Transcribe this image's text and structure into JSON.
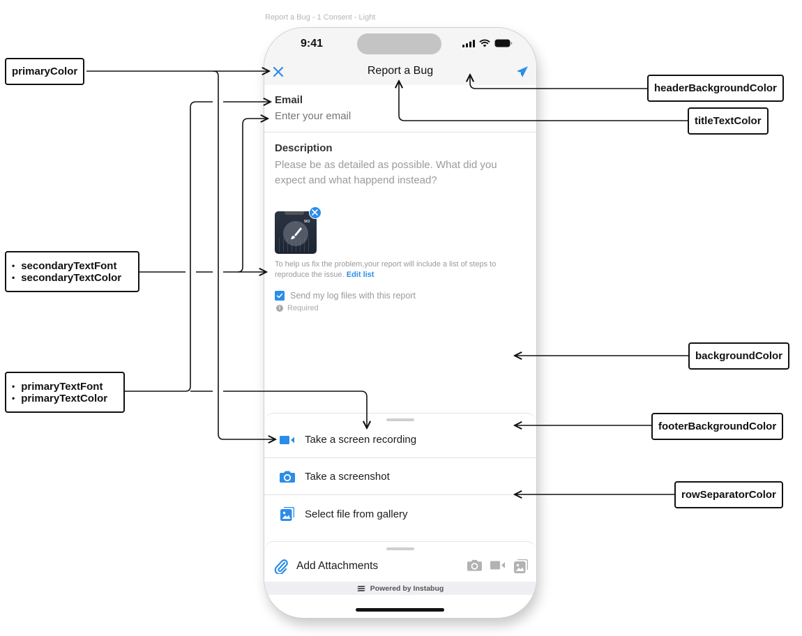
{
  "frame_caption": "Report a Bug - 1 Consent - Light",
  "colors": {
    "primary": "#2c8de8",
    "header_background": "#f5f5f5",
    "background": "#ffffff",
    "secondary_text": "#9a9a9a",
    "row_separator": "#e0e0e0"
  },
  "status_bar": {
    "time": "9:41",
    "icons": [
      "signal-icon",
      "wifi-icon",
      "battery-icon"
    ]
  },
  "header": {
    "title": "Report a Bug",
    "close_icon": "close-icon",
    "send_icon": "send-icon"
  },
  "form": {
    "email_label": "Email",
    "email_placeholder": "Enter your email",
    "description_label": "Description",
    "description_placeholder": "Please be as detailed as possible. What did you expect and what happend instead?",
    "steps_note": "To help us fix the problem,your report will include a list of steps to reproduce the issue.",
    "edit_list_link": "Edit list",
    "log_files_label": "Send my log files with this report",
    "log_files_checked": true,
    "required_label": "Required"
  },
  "attachment_options": [
    {
      "icon": "video-icon",
      "label": "Take a screen recording"
    },
    {
      "icon": "camera-icon",
      "label": "Take a screenshot"
    },
    {
      "icon": "gallery-icon",
      "label": "Select file from gallery"
    }
  ],
  "attach_bar": {
    "label": "Add Attachments",
    "icons": [
      "camera-icon",
      "video-icon",
      "gallery-icon"
    ]
  },
  "powered_by": "Powered by Instabug",
  "annotations": {
    "primaryColor": "primaryColor",
    "secondary": [
      "secondaryTextFont",
      "secondaryTextColor"
    ],
    "primary": [
      "primaryTextFont",
      "primaryTextColor"
    ],
    "headerBackgroundColor": "headerBackgroundColor",
    "titleTextColor": "titleTextColor",
    "backgroundColor": "backgroundColor",
    "footerBackgroundColor": "footerBackgroundColor",
    "rowSeparatorColor": "rowSeparatorColor"
  }
}
